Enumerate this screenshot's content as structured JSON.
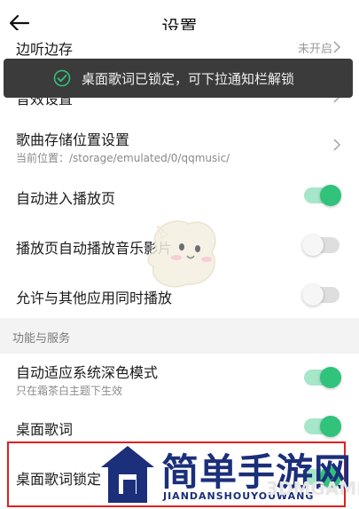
{
  "header": {
    "title": "设置",
    "back_icon": "back-arrow-icon"
  },
  "toast": {
    "text": "桌面歌词已锁定，可下拉通知栏解锁",
    "icon": "check-circle-icon",
    "accent": "#31c27c"
  },
  "settings": {
    "partial_top": {
      "label": "边听边存",
      "value": "未开启"
    },
    "sound_effects": {
      "label": "音效设置"
    },
    "storage": {
      "label": "歌曲存储位置设置",
      "sub": "当前位置：/storage/emulated/0/qqmusic/"
    },
    "auto_enter_player": {
      "label": "自动进入播放页",
      "on": true
    },
    "auto_play_video": {
      "label": "播放页自动播放音乐影片",
      "on": false
    },
    "simultaneous_play": {
      "label": "允许与其他应用同时播放",
      "on": false
    }
  },
  "section": {
    "title": "功能与服务"
  },
  "features": {
    "dark_mode": {
      "label": "自动适应系统深色模式",
      "sub": "只在霜茶白主题下生效",
      "on": true
    },
    "desktop_lyrics": {
      "label": "桌面歌词",
      "on": true
    },
    "desktop_lyrics_lock": {
      "label": "桌面歌词锁定",
      "on": true
    }
  },
  "watermark": {
    "text": "简单手游网",
    "pinyin": "JIANDANSHOUYOUWANG",
    "brand": "3DMGAME"
  },
  "colors": {
    "toggle_on": "#31c27c",
    "highlight": "#e02020",
    "watermark": "#1b2f7a"
  }
}
